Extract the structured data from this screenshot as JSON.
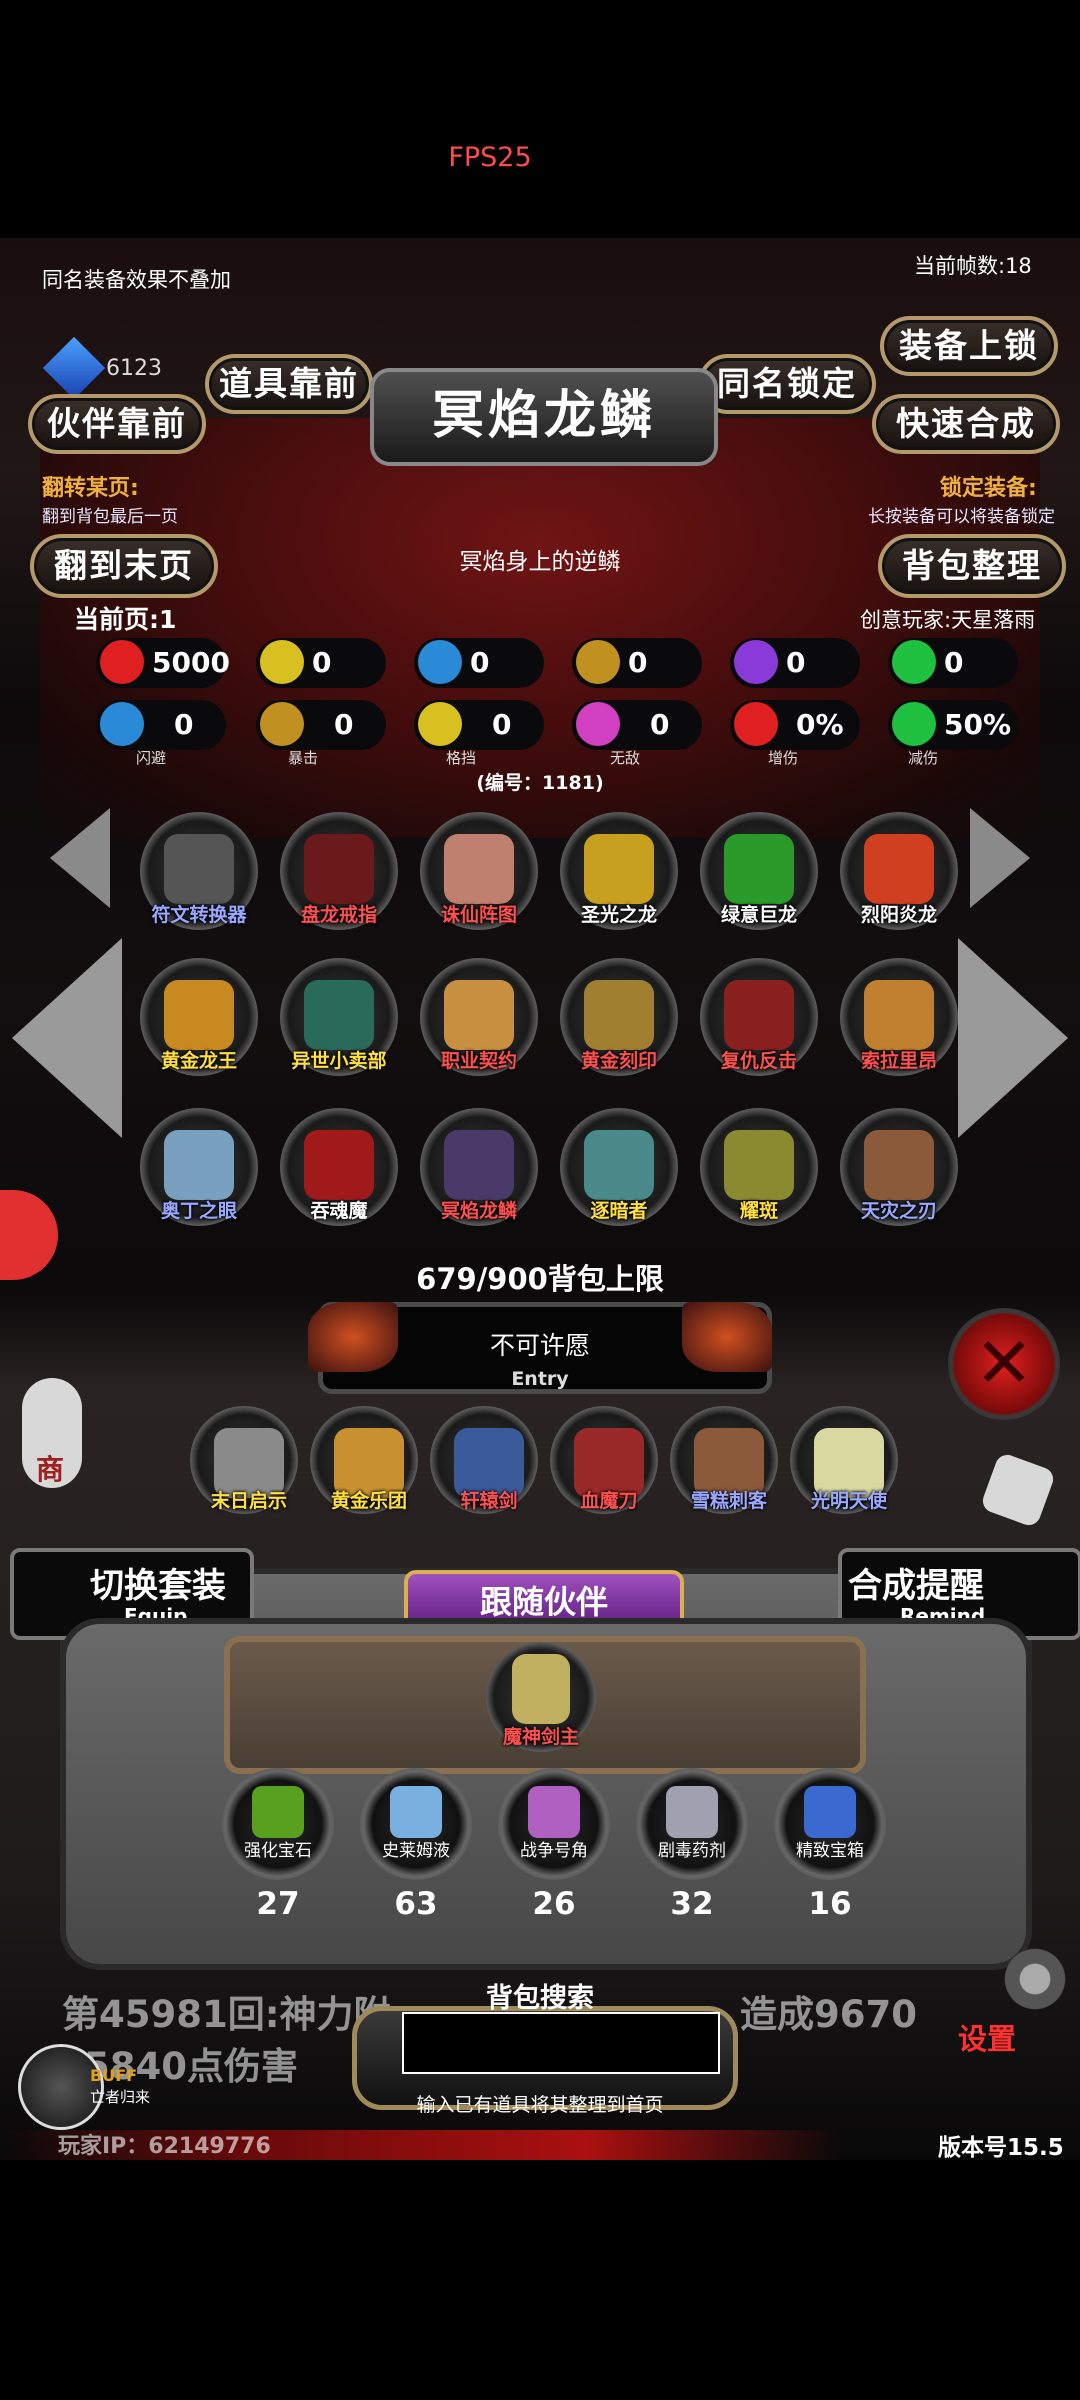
{
  "fps": "FPS25",
  "top_notes": {
    "left": "同名装备效果不叠加",
    "right": "当前帧数:18"
  },
  "currency": "6123",
  "buttons": {
    "items_first": "道具靠前",
    "partner_first": "伙伴靠前",
    "same_name_lock": "同名锁定",
    "equip_lock": "装备上锁",
    "quick_merge": "快速合成",
    "to_last_page": "翻到末页",
    "bag_sort": "背包整理",
    "switch_set": "切换套装",
    "switch_set_sub": "Equip",
    "merge_remind": "合成提醒",
    "merge_remind_sub": "Remind"
  },
  "item_title": "冥焰龙鳞",
  "item_desc": "冥焰身上的逆鳞",
  "flip_hint": {
    "title": "翻转某页:",
    "sub": "翻到背包最后一页"
  },
  "lock_hint": {
    "title": "锁定装备:",
    "sub": "长按装备可以将装备锁定"
  },
  "current_page": "当前页:1",
  "creator": "创意玩家:天星落雨",
  "stats_row1": [
    {
      "icon": "heart-icon",
      "value": "5000",
      "color": "#e02020"
    },
    {
      "icon": "armor-icon",
      "value": "0",
      "color": "#d8c020"
    },
    {
      "icon": "helmet-icon",
      "value": "0",
      "color": "#2a8ad8"
    },
    {
      "icon": "sword-icon",
      "value": "0",
      "color": "#c09020"
    },
    {
      "icon": "lightning-icon",
      "value": "0",
      "color": "#8a3ad8"
    },
    {
      "icon": "clover-icon",
      "value": "0",
      "color": "#20c040"
    }
  ],
  "stats_row2": [
    {
      "icon": "dodge-icon",
      "value": "0",
      "label": "闪避",
      "color": "#2a8ad8"
    },
    {
      "icon": "crit-icon",
      "value": "0",
      "label": "暴击",
      "color": "#c09020"
    },
    {
      "icon": "block-icon",
      "value": "0",
      "label": "格挡",
      "color": "#d8c020"
    },
    {
      "icon": "invincible-icon",
      "value": "0",
      "label": "无敌",
      "color": "#d040c0"
    },
    {
      "icon": "damage-up-icon",
      "value": "0%",
      "label": "增伤",
      "color": "#e02020"
    },
    {
      "icon": "damage-reduce-icon",
      "value": "50%",
      "label": "减伤",
      "color": "#20c040"
    }
  ],
  "item_number": "(编号：1181)",
  "inventory": [
    {
      "name": "符文转换器",
      "color": "#9aa8ff",
      "art": "#555"
    },
    {
      "name": "盘龙戒指",
      "color": "#ff5050",
      "art": "#6a1a1a"
    },
    {
      "name": "诛仙阵图",
      "color": "#ff5050",
      "art": "#c08070"
    },
    {
      "name": "圣光之龙",
      "color": "#ffffff",
      "art": "#c8a020"
    },
    {
      "name": "绿意巨龙",
      "color": "#ffffff",
      "art": "#2a9a2a"
    },
    {
      "name": "烈阳炎龙",
      "color": "#ffffff",
      "art": "#d04020"
    },
    {
      "name": "黄金龙王",
      "color": "#ffe040",
      "art": "#c88a20"
    },
    {
      "name": "异世小卖部",
      "color": "#ffe040",
      "art": "#2a6a5a"
    },
    {
      "name": "职业契约",
      "color": "#ff5050",
      "art": "#c89040"
    },
    {
      "name": "黄金刻印",
      "color": "#ff5050",
      "art": "#a08030"
    },
    {
      "name": "复仇反击",
      "color": "#ff5050",
      "art": "#8a2020"
    },
    {
      "name": "索拉里昂",
      "color": "#ff5050",
      "art": "#c08030"
    },
    {
      "name": "奥丁之眼",
      "color": "#9aa8ff",
      "art": "#7aa0c0"
    },
    {
      "name": "吞魂魔",
      "color": "#ffffff",
      "art": "#a01a1a"
    },
    {
      "name": "冥焰龙鳞",
      "color": "#ff5050",
      "art": "#4a3a6a"
    },
    {
      "name": "逐暗者",
      "color": "#ffe040",
      "art": "#4a8a8a"
    },
    {
      "name": "耀斑",
      "color": "#ffe040",
      "art": "#8a8a30"
    },
    {
      "name": "天灾之刃",
      "color": "#9aa8ff",
      "art": "#8a5a3a"
    }
  ],
  "bag_limit": "679/900背包上限",
  "wish": {
    "title": "不可许愿",
    "sub": "Entry"
  },
  "equipped": [
    {
      "name": "末日启示",
      "color": "#ffe040",
      "art": "#8a8a8a"
    },
    {
      "name": "黄金乐团",
      "color": "#ffe040",
      "art": "#c89030"
    },
    {
      "name": "轩辕剑",
      "color": "#ff5050",
      "art": "#3a5a9a"
    },
    {
      "name": "血魔刀",
      "color": "#ff5050",
      "art": "#9a2a2a"
    },
    {
      "name": "雪糕刺客",
      "color": "#9aa8ff",
      "art": "#8a5a3a"
    },
    {
      "name": "光明天使",
      "color": "#9aa8ff",
      "art": "#d8d8a0"
    }
  ],
  "partner": {
    "title": "跟随伙伴",
    "name": "魔神剑主"
  },
  "materials": [
    {
      "name": "强化宝石",
      "count": "27",
      "art": "#5aa020"
    },
    {
      "name": "史莱姆液",
      "count": "63",
      "art": "#7ab0e0"
    },
    {
      "name": "战争号角",
      "count": "26",
      "art": "#b060c0"
    },
    {
      "name": "剧毒药剂",
      "count": "32",
      "art": "#a0a0b0"
    },
    {
      "name": "精致宝箱",
      "count": "16",
      "art": "#3a6ad0"
    }
  ],
  "log_text": {
    "line1": "第45981回:神力附",
    "line1b": "造成9670",
    "line2": "5840点伤害"
  },
  "bag_search": {
    "title": "背包搜索",
    "placeholder": "",
    "hint": "输入已有道具将其整理到首页"
  },
  "buff": {
    "label": "BUFF",
    "sub": "亡者归来"
  },
  "settings": "设置",
  "shop": "商",
  "player_ip": "玩家IP：62149776",
  "version": "版本号15.5"
}
